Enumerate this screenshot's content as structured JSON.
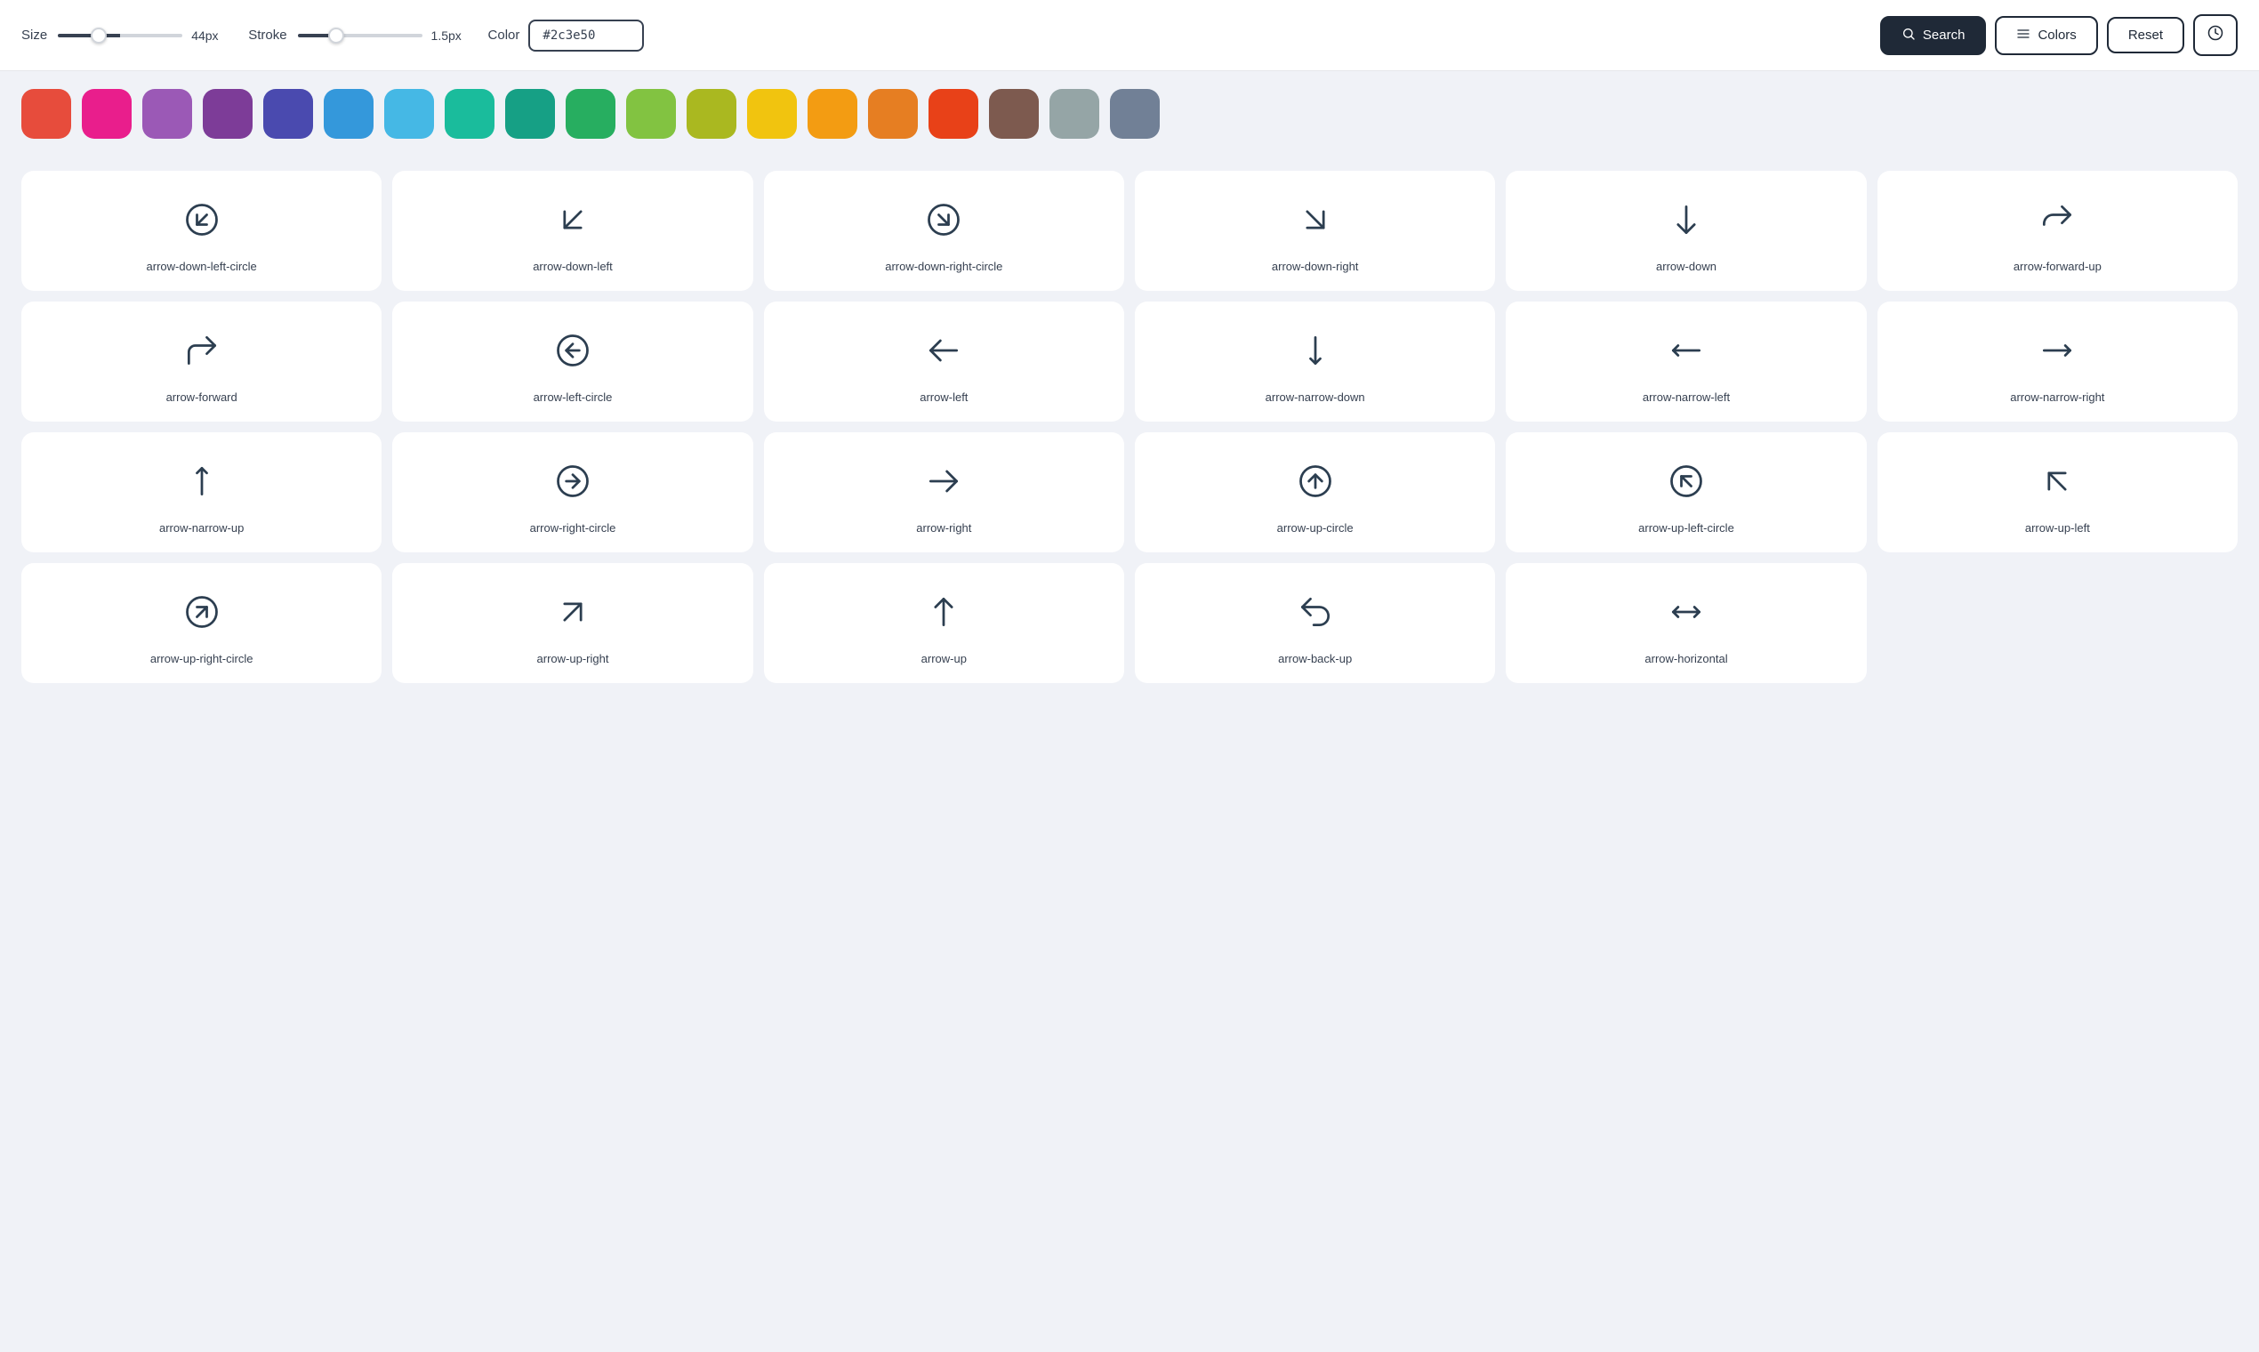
{
  "toolbar": {
    "size_label": "Size",
    "size_value": "44px",
    "size_min": 8,
    "size_max": 128,
    "size_current": 44,
    "stroke_label": "Stroke",
    "stroke_value": "1.5px",
    "stroke_min": 0.5,
    "stroke_max": 4,
    "stroke_current": 1.5,
    "color_label": "Color",
    "color_value": "#2c3e50",
    "search_label": "Search",
    "colors_label": "Colors",
    "reset_label": "Reset",
    "history_icon": "🕐"
  },
  "colors": [
    {
      "name": "red",
      "hex": "#e74c3c"
    },
    {
      "name": "crimson",
      "hex": "#e91e8c"
    },
    {
      "name": "purple-light",
      "hex": "#9b59b6"
    },
    {
      "name": "purple",
      "hex": "#7d3c98"
    },
    {
      "name": "indigo",
      "hex": "#4a4aaf"
    },
    {
      "name": "blue",
      "hex": "#3498db"
    },
    {
      "name": "sky",
      "hex": "#45b8e5"
    },
    {
      "name": "cyan",
      "hex": "#1abc9c"
    },
    {
      "name": "teal",
      "hex": "#16a085"
    },
    {
      "name": "green",
      "hex": "#27ae60"
    },
    {
      "name": "light-green",
      "hex": "#82c341"
    },
    {
      "name": "lime",
      "hex": "#aab820"
    },
    {
      "name": "yellow",
      "hex": "#f1c40f"
    },
    {
      "name": "amber",
      "hex": "#f39c12"
    },
    {
      "name": "orange",
      "hex": "#e67e22"
    },
    {
      "name": "orange-red",
      "hex": "#e84118"
    },
    {
      "name": "brown",
      "hex": "#7d5a4f"
    },
    {
      "name": "gray",
      "hex": "#95a5a6"
    },
    {
      "name": "slate",
      "hex": "#718096"
    }
  ],
  "icons": [
    {
      "id": "arrow-down-left-circle",
      "label": "arrow-down-left-circle",
      "type": "circle-arrow-down-left"
    },
    {
      "id": "arrow-down-left",
      "label": "arrow-down-left",
      "type": "arrow-down-left"
    },
    {
      "id": "arrow-down-right-circle",
      "label": "arrow-down-right-circle",
      "type": "circle-arrow-down-right"
    },
    {
      "id": "arrow-down-right",
      "label": "arrow-down-right",
      "type": "arrow-down-right"
    },
    {
      "id": "arrow-down",
      "label": "arrow-down",
      "type": "arrow-down"
    },
    {
      "id": "arrow-forward-up",
      "label": "arrow-forward-up",
      "type": "arrow-forward-up"
    },
    {
      "id": "arrow-forward",
      "label": "arrow-forward",
      "type": "arrow-forward"
    },
    {
      "id": "arrow-left-circle",
      "label": "arrow-left-circle",
      "type": "circle-arrow-left"
    },
    {
      "id": "arrow-left",
      "label": "arrow-left",
      "type": "arrow-left"
    },
    {
      "id": "arrow-narrow-down",
      "label": "arrow-narrow-down",
      "type": "arrow-narrow-down"
    },
    {
      "id": "arrow-narrow-left",
      "label": "arrow-narrow-left",
      "type": "arrow-narrow-left"
    },
    {
      "id": "arrow-narrow-right",
      "label": "arrow-narrow-right",
      "type": "arrow-narrow-right"
    },
    {
      "id": "arrow-narrow-up",
      "label": "arrow-narrow-up",
      "type": "arrow-narrow-up"
    },
    {
      "id": "arrow-right-circle",
      "label": "arrow-right-circle",
      "type": "circle-arrow-right"
    },
    {
      "id": "arrow-right",
      "label": "arrow-right",
      "type": "arrow-right"
    },
    {
      "id": "arrow-up-circle",
      "label": "arrow-up-circle",
      "type": "circle-arrow-up"
    },
    {
      "id": "arrow-up-left-circle",
      "label": "arrow-up-left-circle",
      "type": "circle-arrow-up-left"
    },
    {
      "id": "arrow-up-left",
      "label": "arrow-up-left",
      "type": "arrow-up-left"
    },
    {
      "id": "arrow-up-right-circle",
      "label": "arrow-up-right-circle",
      "type": "circle-arrow-up-right"
    },
    {
      "id": "arrow-up-right",
      "label": "arrow-up-right",
      "type": "arrow-up-right"
    },
    {
      "id": "arrow-up",
      "label": "arrow-up",
      "type": "arrow-up"
    },
    {
      "id": "arrow-back-up",
      "label": "arrow-back-up",
      "type": "arrow-back-up"
    },
    {
      "id": "arrow-horizontal",
      "label": "arrow-horizontal",
      "type": "arrow-horizontal"
    }
  ]
}
